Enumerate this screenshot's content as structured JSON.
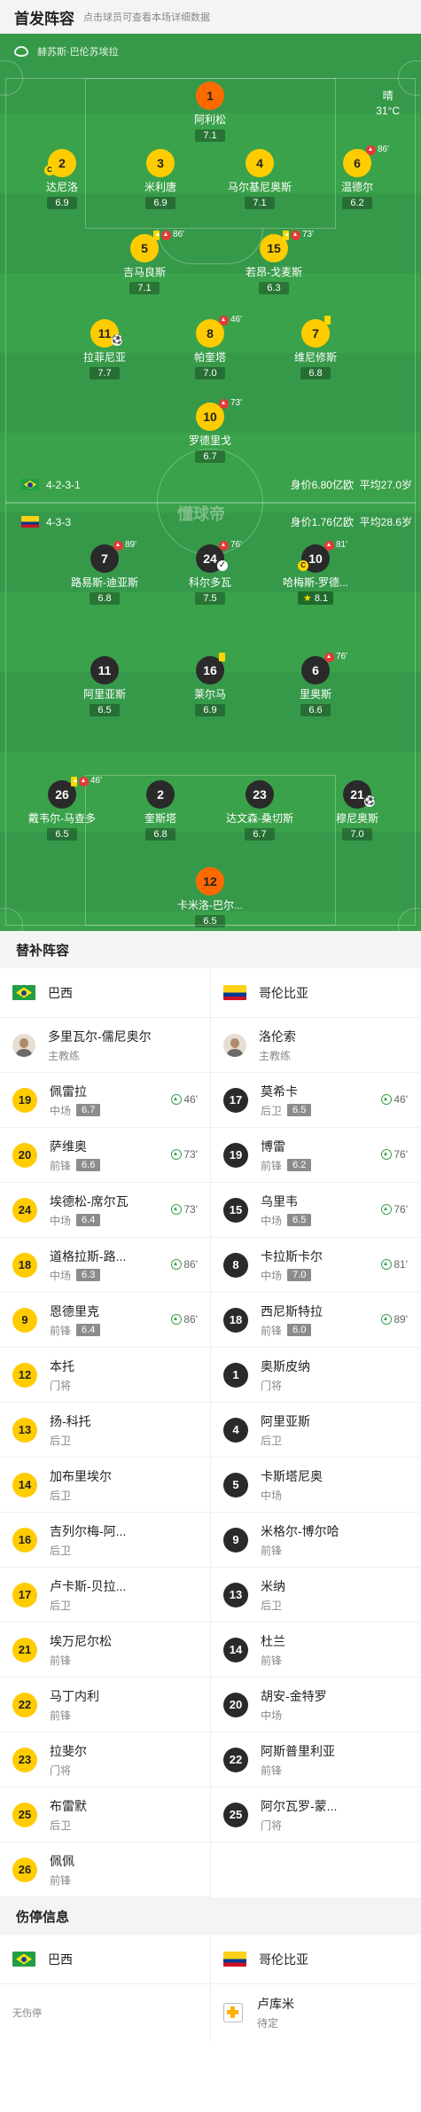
{
  "header": {
    "title": "首发阵容",
    "subtitle": "点击球员可查看本场详细数据"
  },
  "venue": "赫苏斯·巴伦苏埃拉",
  "weather": {
    "condition": "晴",
    "temp": "31°C"
  },
  "watermark": "懂球帝",
  "home_team": {
    "name": "巴西",
    "formation": "4-2-3-1",
    "value": "身价6.80亿欧",
    "avg_age": "平均27.0岁"
  },
  "away_team": {
    "name": "哥伦比亚",
    "formation": "4-3-3",
    "value": "身价1.76亿欧",
    "avg_age": "平均28.6岁"
  },
  "home_players": [
    {
      "num": "1",
      "name": "阿利松",
      "rating": "7.1"
    },
    {
      "num": "2",
      "name": "达尼洛",
      "rating": "6.9"
    },
    {
      "num": "3",
      "name": "米利唐",
      "rating": "6.9"
    },
    {
      "num": "4",
      "name": "马尔基尼奥斯",
      "rating": "7.1"
    },
    {
      "num": "6",
      "name": "温德尔",
      "rating": "6.2",
      "sub": "86'"
    },
    {
      "num": "5",
      "name": "吉马良斯",
      "rating": "7.1",
      "sub": "86'"
    },
    {
      "num": "15",
      "name": "若昂-戈麦斯",
      "rating": "6.3",
      "sub": "73'"
    },
    {
      "num": "11",
      "name": "拉菲尼亚",
      "rating": "7.7"
    },
    {
      "num": "8",
      "name": "帕奎塔",
      "rating": "7.0",
      "sub": "46'"
    },
    {
      "num": "7",
      "name": "维尼修斯",
      "rating": "6.8"
    },
    {
      "num": "10",
      "name": "罗德里戈",
      "rating": "6.7",
      "sub": "73'"
    }
  ],
  "away_players": [
    {
      "num": "7",
      "name": "路易斯-迪亚斯",
      "rating": "6.8",
      "sub": "89'"
    },
    {
      "num": "24",
      "name": "科尔多瓦",
      "rating": "7.5",
      "sub": "76'"
    },
    {
      "num": "10",
      "name": "哈梅斯-罗德...",
      "rating": "8.1",
      "sub": "81'"
    },
    {
      "num": "11",
      "name": "阿里亚斯",
      "rating": "6.5"
    },
    {
      "num": "16",
      "name": "莱尔马",
      "rating": "6.9"
    },
    {
      "num": "6",
      "name": "里奥斯",
      "rating": "6.6",
      "sub": "76'"
    },
    {
      "num": "26",
      "name": "戴韦尔-马查多",
      "rating": "6.5",
      "sub": "46'"
    },
    {
      "num": "2",
      "name": "奎斯塔",
      "rating": "6.8"
    },
    {
      "num": "23",
      "name": "达文森-桑切斯",
      "rating": "6.7"
    },
    {
      "num": "21",
      "name": "穆尼奥斯",
      "rating": "7.0"
    },
    {
      "num": "12",
      "name": "卡米洛-巴尔...",
      "rating": "6.5"
    }
  ],
  "subs_title": "替补阵容",
  "home_coach": {
    "name": "多里瓦尔-儒尼奥尔",
    "role": "主教练"
  },
  "away_coach": {
    "name": "洛伦索",
    "role": "主教练"
  },
  "home_subs": [
    {
      "num": "19",
      "name": "佩雷拉",
      "pos": "中场",
      "rating": "6.7",
      "time": "46'"
    },
    {
      "num": "20",
      "name": "萨维奥",
      "pos": "前锋",
      "rating": "6.6",
      "time": "73'"
    },
    {
      "num": "24",
      "name": "埃德松-席尔瓦",
      "pos": "中场",
      "rating": "6.4",
      "time": "73'"
    },
    {
      "num": "18",
      "name": "道格拉斯-路...",
      "pos": "中场",
      "rating": "6.3",
      "time": "86'"
    },
    {
      "num": "9",
      "name": "恩德里克",
      "pos": "前锋",
      "rating": "6.4",
      "time": "86'"
    },
    {
      "num": "12",
      "name": "本托",
      "pos": "门将"
    },
    {
      "num": "13",
      "name": "扬-科托",
      "pos": "后卫"
    },
    {
      "num": "14",
      "name": "加布里埃尔",
      "pos": "后卫"
    },
    {
      "num": "16",
      "name": "吉列尔梅-阿...",
      "pos": "后卫"
    },
    {
      "num": "17",
      "name": "卢卡斯-贝拉...",
      "pos": "后卫"
    },
    {
      "num": "21",
      "name": "埃万尼尔松",
      "pos": "前锋"
    },
    {
      "num": "22",
      "name": "马丁内利",
      "pos": "前锋"
    },
    {
      "num": "23",
      "name": "拉斐尔",
      "pos": "门将"
    },
    {
      "num": "25",
      "name": "布雷默",
      "pos": "后卫"
    },
    {
      "num": "26",
      "name": "佩佩",
      "pos": "前锋"
    }
  ],
  "away_subs": [
    {
      "num": "17",
      "name": "莫希卡",
      "pos": "后卫",
      "rating": "6.5",
      "time": "46'"
    },
    {
      "num": "19",
      "name": "博雷",
      "pos": "前锋",
      "rating": "6.2",
      "time": "76'"
    },
    {
      "num": "15",
      "name": "乌里韦",
      "pos": "中场",
      "rating": "6.5",
      "time": "76'"
    },
    {
      "num": "8",
      "name": "卡拉斯卡尔",
      "pos": "中场",
      "rating": "7.0",
      "time": "81'"
    },
    {
      "num": "18",
      "name": "西尼斯特拉",
      "pos": "前锋",
      "rating": "6.0",
      "time": "89'"
    },
    {
      "num": "1",
      "name": "奥斯皮纳",
      "pos": "门将"
    },
    {
      "num": "4",
      "name": "阿里亚斯",
      "pos": "后卫"
    },
    {
      "num": "5",
      "name": "卡斯塔尼奥",
      "pos": "中场"
    },
    {
      "num": "9",
      "name": "米格尔-博尔哈",
      "pos": "前锋"
    },
    {
      "num": "13",
      "name": "米纳",
      "pos": "后卫"
    },
    {
      "num": "14",
      "name": "杜兰",
      "pos": "前锋"
    },
    {
      "num": "20",
      "name": "胡安-金特罗",
      "pos": "中场"
    },
    {
      "num": "22",
      "name": "阿斯普里利亚",
      "pos": "前锋"
    },
    {
      "num": "25",
      "name": "阿尔瓦罗-蒙...",
      "pos": "门将"
    }
  ],
  "injury_title": "伤停信息",
  "home_injury": "无伤停",
  "away_injury": {
    "name": "卢库米",
    "status": "待定"
  }
}
